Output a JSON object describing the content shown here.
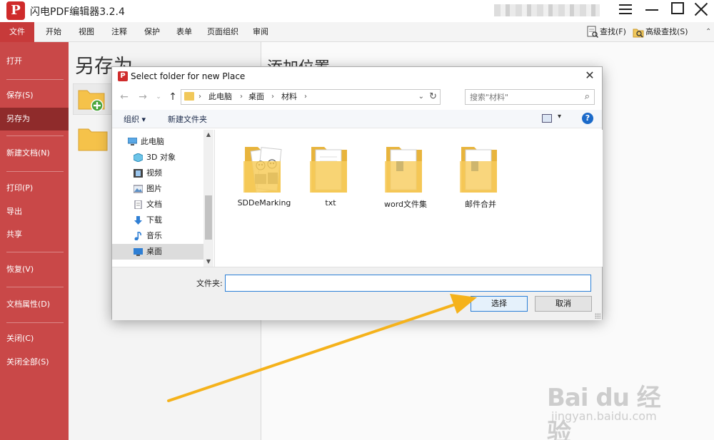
{
  "app": {
    "logo_letter": "P",
    "title": "闪电PDF编辑器3.2.4",
    "accent_color": "#c94848"
  },
  "menubar": {
    "items": [
      "文件",
      "开始",
      "视图",
      "注释",
      "保护",
      "表单",
      "页面组织",
      "审阅"
    ],
    "find": "查找(F)",
    "advanced_find": "高级查找(S)"
  },
  "sidebar": {
    "items": [
      "打开",
      "保存(S)",
      "另存为",
      "新建文档(N)",
      "打印(P)",
      "导出",
      "共享",
      "恢复(V)",
      "文档属性(D)",
      "关闭(C)",
      "关闭全部(S)"
    ]
  },
  "left_panel": {
    "title": "另存为"
  },
  "right_panel": {
    "title": "添加位置"
  },
  "dialog": {
    "title": "Select folder for new Place",
    "breadcrumb": [
      "此电脑",
      "桌面",
      "材料"
    ],
    "search_placeholder": "搜索\"材料\"",
    "organize": "组织 ▾",
    "new_folder": "新建文件夹",
    "tree": [
      {
        "label": "此电脑",
        "icon": "computer-icon"
      },
      {
        "label": "3D 对象",
        "icon": "cube-icon"
      },
      {
        "label": "视频",
        "icon": "video-icon"
      },
      {
        "label": "图片",
        "icon": "picture-icon"
      },
      {
        "label": "文档",
        "icon": "document-icon"
      },
      {
        "label": "下载",
        "icon": "download-icon"
      },
      {
        "label": "音乐",
        "icon": "music-icon"
      },
      {
        "label": "桌面",
        "icon": "desktop-icon"
      }
    ],
    "files": [
      "SDDeMarking",
      "txt",
      "word文件集",
      "邮件合并"
    ],
    "folder_label": "文件夹:",
    "folder_value": "",
    "select_button": "选择",
    "cancel_button": "取消"
  },
  "watermark": {
    "main": "Bai du 经验",
    "sub": "jingyan.baidu.com"
  }
}
